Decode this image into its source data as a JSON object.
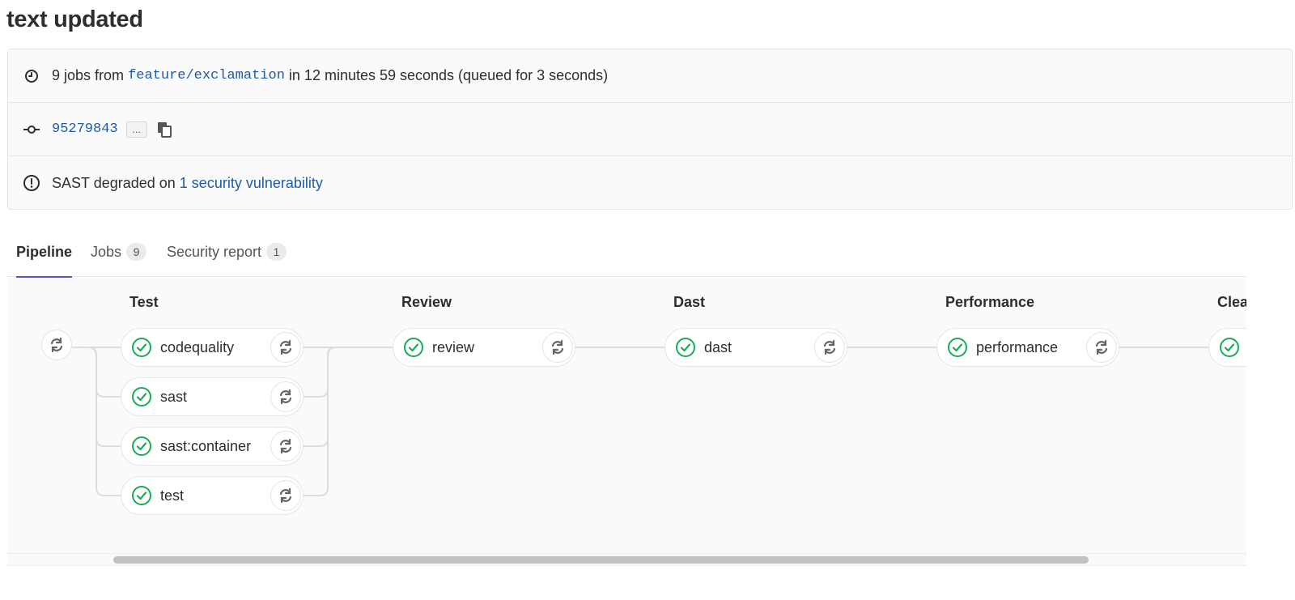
{
  "page": {
    "title": "text updated"
  },
  "info": {
    "jobs_count_text": "9 jobs from",
    "branch": "feature/exclamation",
    "duration_text": "in 12 minutes 59 seconds (queued for 3 seconds)",
    "commit_sha": "95279843",
    "ellipsis_label": "...",
    "sast_text": "SAST degraded on",
    "sast_link": "1 security vulnerability"
  },
  "tabs": [
    {
      "label": "Pipeline",
      "active": true
    },
    {
      "label": "Jobs",
      "badge": "9"
    },
    {
      "label": "Security report",
      "badge": "1"
    }
  ],
  "stages": [
    {
      "title": "Test",
      "jobs": [
        "codequality",
        "sast",
        "sast:container",
        "test"
      ]
    },
    {
      "title": "Review",
      "jobs": [
        "review"
      ]
    },
    {
      "title": "Dast",
      "jobs": [
        "dast"
      ]
    },
    {
      "title": "Performance",
      "jobs": [
        "performance"
      ]
    },
    {
      "title": "Clea",
      "jobs": [
        ""
      ]
    }
  ],
  "icons": {
    "pipeline_duration": "clock-icon",
    "commit": "commit-icon",
    "copy": "copy-icon",
    "warning": "warning-circle-icon",
    "job_status": "success-check-icon",
    "retry": "retry-icon"
  },
  "colors": {
    "link": "#1f5aa6",
    "success": "#1aaa55",
    "tab_active": "#6b4fbb"
  }
}
